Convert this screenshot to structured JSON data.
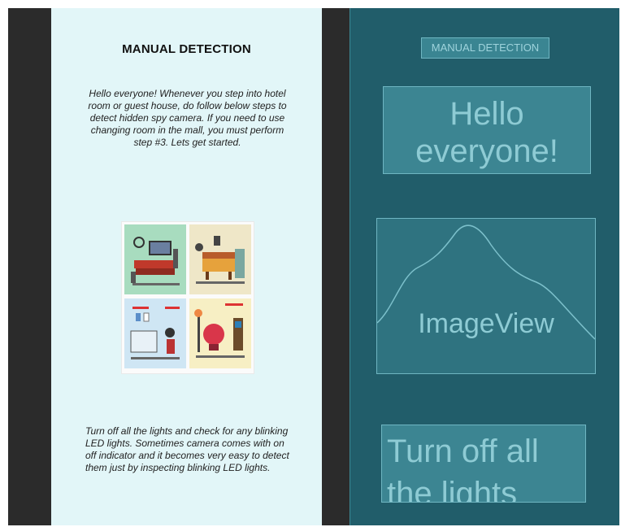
{
  "design": {
    "title": "MANUAL DETECTION",
    "intro": "Hello everyone!  Whenever you step into hotel room or guest house, do follow below steps to detect hidden spy camera. If you need to use changing room in the mall, you must perform step #3.  Lets get started.",
    "step_text": "Turn off all the lights and check for any blinking LED lights. Sometimes camera comes with on off indicator and it becomes very easy to detect them just by inspecting blinking LED lights."
  },
  "blueprint": {
    "title": "MANUAL DETECTION",
    "hello": "Hello everyone!",
    "image_label": "ImageView",
    "turn_off": "Turn off all the lights"
  },
  "colors": {
    "design_bg": "#e2f6f8",
    "blueprint_bg": "#215d6a",
    "canvas_bg": "#2b2b2b"
  }
}
